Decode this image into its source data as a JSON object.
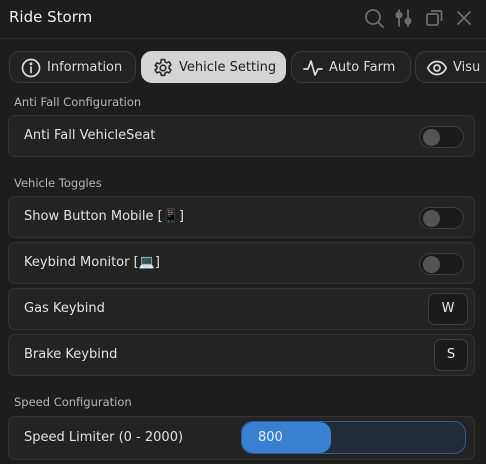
{
  "window": {
    "title": "Ride Storm"
  },
  "tabs": [
    {
      "label": "Information",
      "icon": "info-icon",
      "active": false
    },
    {
      "label": "Vehicle Setting",
      "icon": "gear-icon",
      "active": true
    },
    {
      "label": "Auto Farm",
      "icon": "activity-icon",
      "active": false
    },
    {
      "label": "Visu",
      "icon": "eye-icon",
      "active": false
    }
  ],
  "sections": {
    "anti_fall": {
      "title": "Anti Fall Configuration",
      "anti_fall_vehicleseat": {
        "label": "Anti Fall VehicleSeat",
        "enabled": false
      }
    },
    "vehicle_toggles": {
      "title": "Vehicle Toggles",
      "show_button_mobile": {
        "label": "Show Button Mobile [📱]",
        "enabled": false
      },
      "keybind_monitor": {
        "label": "Keybind Monitor [💻]",
        "enabled": false
      },
      "gas_keybind": {
        "label": "Gas Keybind",
        "key": "W"
      },
      "brake_keybind": {
        "label": "Brake Keybind",
        "key": "S"
      }
    },
    "speed": {
      "title": "Speed Configuration",
      "speed_limiter": {
        "label": "Speed Limiter (0 - 2000)",
        "value": "800",
        "min": 0,
        "max": 2000,
        "fraction": 0.4
      }
    }
  },
  "colors": {
    "accent": "#3a80d0",
    "background": "#1d1d1d",
    "row_background": "#232323",
    "active_tab": "#d4d4d4"
  }
}
